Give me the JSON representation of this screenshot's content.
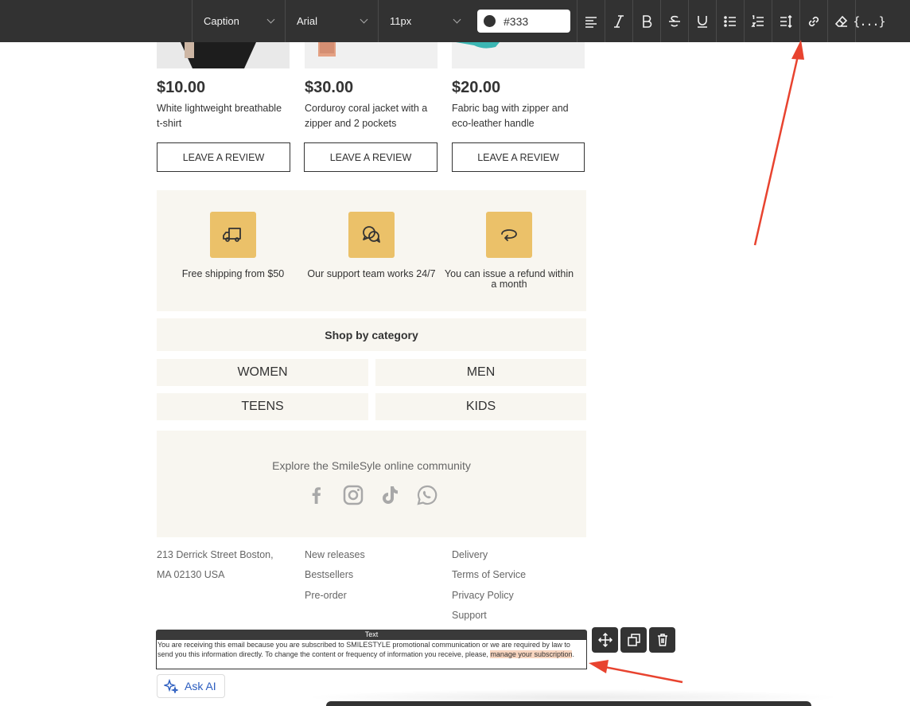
{
  "toolbar": {
    "style_select": "Caption",
    "font_select": "Arial",
    "size_select": "11px",
    "color_value": "#333",
    "merge_tags_label": "{...}"
  },
  "products": [
    {
      "price": "$10.00",
      "description": "White lightweight breathable t-shirt",
      "button": "LEAVE A REVIEW"
    },
    {
      "price": "$30.00",
      "description": "Corduroy coral jacket with  a zipper and 2 pockets",
      "button": "LEAVE A REVIEW"
    },
    {
      "price": "$20.00",
      "description": "Fabric bag with zipper and eco-leather handle",
      "button": "LEAVE A REVIEW"
    }
  ],
  "features": [
    {
      "icon": "truck-icon",
      "text": "Free shipping from $50"
    },
    {
      "icon": "chat-bubbles-icon",
      "text": "Our support team works 24/7"
    },
    {
      "icon": "refund-arrow-icon",
      "text": "You can issue a refund within a month"
    }
  ],
  "shop_category": {
    "title": "Shop by category",
    "items": [
      "WOMEN",
      "MEN",
      "TEENS",
      "KIDS"
    ]
  },
  "community": {
    "text": "Explore the SmileSyle online community",
    "socials": [
      "facebook-icon",
      "instagram-icon",
      "tiktok-icon",
      "whatsapp-icon"
    ]
  },
  "footer": {
    "address": [
      "213 Derrick Street Boston,",
      "MA 02130 USA"
    ],
    "links_col1": [
      "New releases",
      "Bestsellers",
      "Pre-order"
    ],
    "links_col2": [
      "Delivery",
      "Terms of Service",
      "Privacy Policy",
      "Support"
    ]
  },
  "selected_block": {
    "label": "Text",
    "text_before": "You are receiving this email because you are subscribed to SMILESTYLE promotional communication or we are required by law to send you this information directly. To change the content or frequency of information you receive, please, ",
    "highlighted": "manage your subscription",
    "text_after": "."
  },
  "ask_ai": {
    "label": "Ask AI"
  },
  "colors": {
    "toolbar_bg": "#323232",
    "section_bg": "#f8f6f0",
    "icon_box": "#ebc169",
    "annotation_arrow": "#e8432f",
    "highlight": "#f8d5bf",
    "ask_ai_text": "#2a5cbf"
  }
}
